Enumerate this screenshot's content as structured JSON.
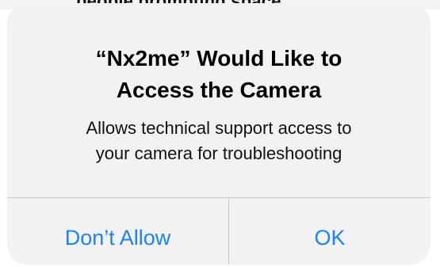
{
  "background": {
    "partial_text": "people prompting space"
  },
  "alert": {
    "title_lines": [
      "“Nx2me” Would Like to",
      "Access the Camera"
    ],
    "message_lines": [
      "Allows technical support access to",
      "your camera for troubleshooting"
    ],
    "buttons": {
      "deny": "Don’t Allow",
      "ok": "OK"
    }
  },
  "colors": {
    "alert_background": "#f2f2f2",
    "button_text": "#1a82fb",
    "divider": "#c8c8cc",
    "title_text": "#000000"
  }
}
